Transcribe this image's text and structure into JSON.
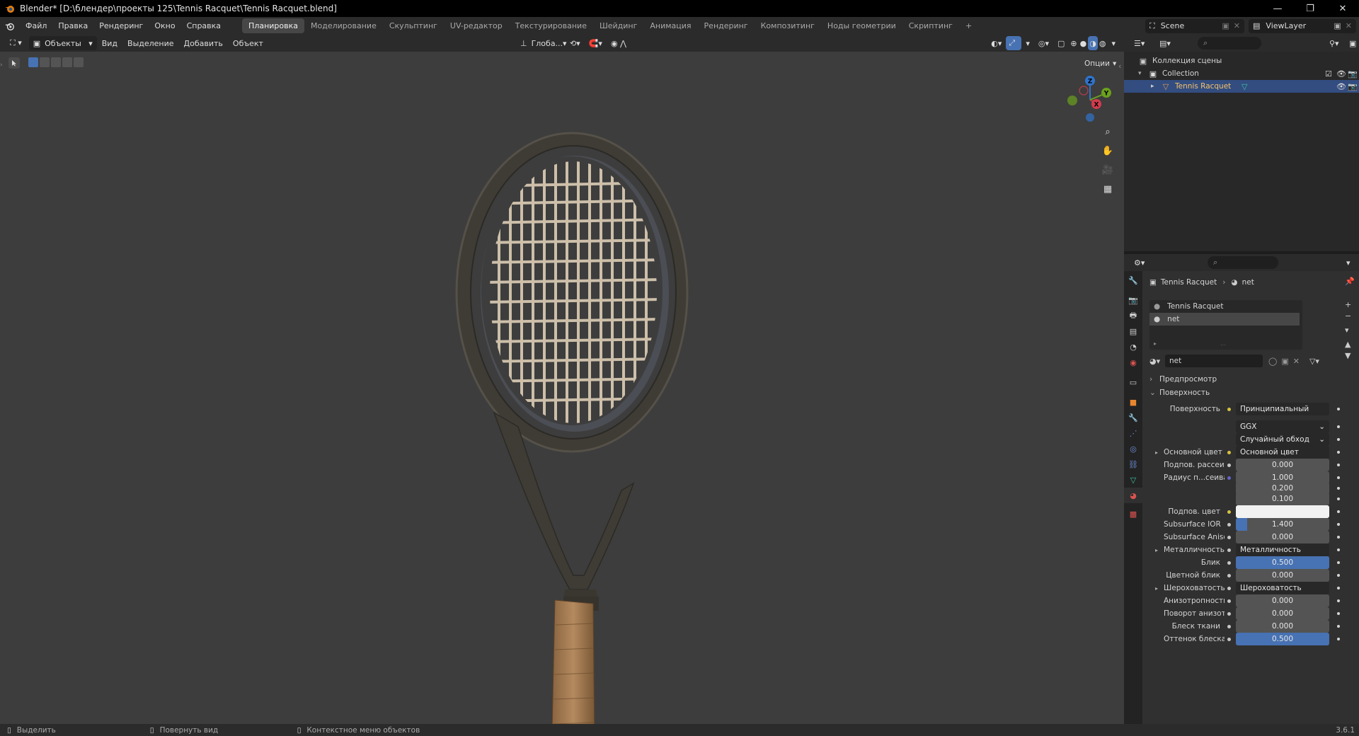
{
  "window": {
    "title": "Blender* [D:\\блендер\\проекты 125\\Tennis Racquet\\Tennis Racquet.blend]",
    "controls": [
      "—",
      "❐",
      "✕"
    ]
  },
  "menu": [
    "Файл",
    "Правка",
    "Рендеринг",
    "Окно",
    "Справка"
  ],
  "workspaces": [
    "Планировка",
    "Моделирование",
    "Скульптинг",
    "UV-редактор",
    "Текстурирование",
    "Шейдинг",
    "Анимация",
    "Рендеринг",
    "Композитинг",
    "Ноды геометрии",
    "Скриптинг",
    "+"
  ],
  "active_workspace_index": 0,
  "scene": {
    "name": "Scene",
    "view_layer": "ViewLayer"
  },
  "viewport_header": {
    "mode": "Объекты",
    "menus": [
      "Вид",
      "Выделение",
      "Добавить",
      "Объект"
    ],
    "orientation": "Глоба...",
    "options": "Опции"
  },
  "gizmo": {
    "x": "X",
    "y": "Y",
    "z": "Z"
  },
  "outliner": {
    "root": "Коллекция сцены",
    "items": [
      {
        "label": "Collection",
        "selected": false
      },
      {
        "label": "Tennis Racquet",
        "selected": true
      }
    ]
  },
  "properties": {
    "breadcrumb": {
      "object": "Tennis Racquet",
      "material": "net"
    },
    "material_slots": [
      "Tennis Racquet",
      "net"
    ],
    "active_slot_index": 1,
    "material_name": "net",
    "panels": {
      "preview": "Предпросмотр",
      "surface": "Поверхность"
    },
    "rows": [
      {
        "label": "Поверхность",
        "value": "Принципиальный BSDF",
        "kind": "link",
        "dot": "yel"
      },
      {
        "label": "",
        "value": "GGX",
        "kind": "select"
      },
      {
        "label": "",
        "value": "Случайный обход",
        "kind": "select"
      },
      {
        "label": "Основной цвет",
        "value": "Основной цвет",
        "kind": "link",
        "dot": "yel",
        "expand": true
      },
      {
        "label": "Подпов. рассеива...",
        "value": "0.000",
        "kind": "num",
        "fill": 0
      },
      {
        "label": "Радиус п...сеивания",
        "value": "1.000",
        "kind": "num",
        "dot": "pur",
        "fill": 0
      },
      {
        "label": "",
        "value": "0.200",
        "kind": "num",
        "fill": 0
      },
      {
        "label": "",
        "value": "0.100",
        "kind": "num",
        "fill": 0
      },
      {
        "label": "Подпов. цвет",
        "value": "",
        "kind": "color",
        "dot": "yel",
        "color": "#f2f2f2"
      },
      {
        "label": "Subsurface IOR",
        "value": "1.400",
        "kind": "num",
        "fill": 0.12
      },
      {
        "label": "Subsurface Anisotr...",
        "value": "0.000",
        "kind": "num",
        "fill": 0
      },
      {
        "label": "Металличность",
        "value": "Металличность",
        "kind": "link",
        "expand": true
      },
      {
        "label": "Блик",
        "value": "0.500",
        "kind": "num",
        "fill": 1
      },
      {
        "label": "Цветной блик",
        "value": "0.000",
        "kind": "num",
        "fill": 0
      },
      {
        "label": "Шероховатость",
        "value": "Шероховатость",
        "kind": "link",
        "expand": true
      },
      {
        "label": "Анизотропность",
        "value": "0.000",
        "kind": "num",
        "fill": 0
      },
      {
        "label": "Поворот анизотро...",
        "value": "0.000",
        "kind": "num",
        "fill": 0
      },
      {
        "label": "Блеск ткани",
        "value": "0.000",
        "kind": "num",
        "fill": 0
      },
      {
        "label": "Оттенок блеска тк...",
        "value": "0.500",
        "kind": "num",
        "fill": 1
      }
    ]
  },
  "status": {
    "select": "Выделить",
    "rotate": "Повернуть вид",
    "context": "Контекстное меню объектов",
    "version": "3.6.1"
  }
}
